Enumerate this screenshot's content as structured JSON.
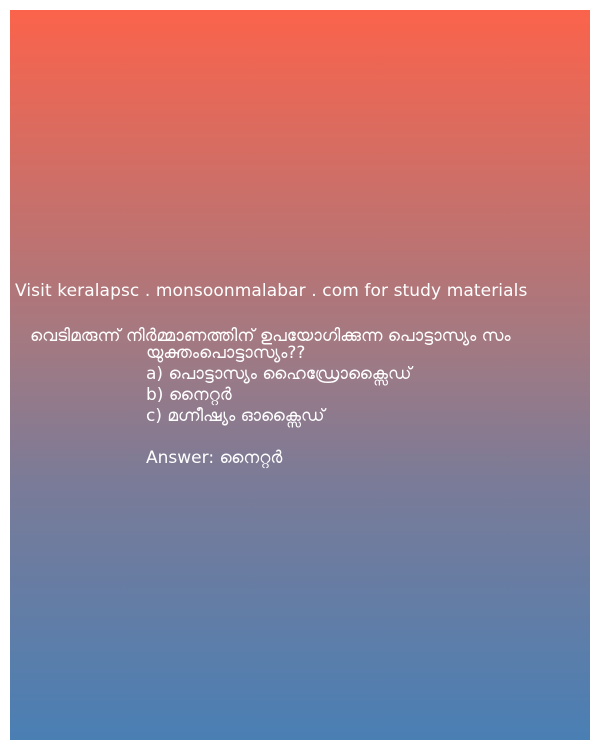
{
  "visit_text": "Visit keralapsc . monsoonmalabar . com for study materials",
  "question": {
    "line1": "വെടിമരുന്ന് നിർമ്മാണത്തിന് ഉപയോഗിക്കുന്ന പൊട്ടാസ്യം സം",
    "line2": "യുക്തംപൊട്ടാസ്യം??"
  },
  "options": [
    "a) പൊട്ടാസ്യം ഹൈഡ്രോക്സൈഡ്",
    "b) നൈറ്റർ",
    "c) മഗ്നീഷ്യം ഓക്സൈഡ്"
  ],
  "answer": "Answer: നൈറ്റർ",
  "colors": {
    "gradient_top": "#fb634b",
    "gradient_bottom": "#4a7fb4",
    "text": "#ffffff"
  }
}
